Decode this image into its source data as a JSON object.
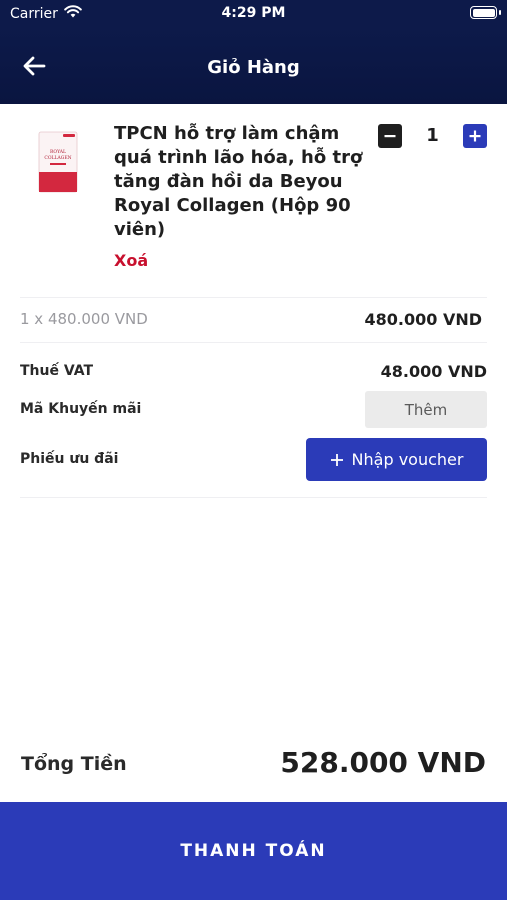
{
  "status_bar": {
    "carrier": "Carrier",
    "time": "4:29 PM"
  },
  "header": {
    "title": "Giỏ Hàng",
    "background_color": "#0d1a4a"
  },
  "cart_item": {
    "name": "TPCN hỗ trợ làm chậm quá trình lão hóa, hỗ trợ tăng đàn hồi da Beyou Royal Collagen (Hộp 90 viên)",
    "remove_label": "Xoá",
    "quantity": "1",
    "line_description": "1 x 480.000 VND",
    "line_total": "480.000 VND",
    "thumbnail_text": [
      "ROYAL",
      "COLLAGEN"
    ]
  },
  "summary": {
    "vat_label": "Thuế VAT",
    "vat_value": "48.000 VND",
    "promo_label": "Mã Khuyến mãi",
    "promo_button": "Thêm",
    "voucher_label": "Phiếu ưu đãi",
    "voucher_button": "Nhập voucher"
  },
  "total": {
    "label": "Tổng Tiền",
    "value": "528.000 VND"
  },
  "checkout": {
    "label": "THANH TOÁN"
  },
  "colors": {
    "primary": "#2b3bb8",
    "danger": "#c8102e",
    "header": "#0d1a4a"
  }
}
